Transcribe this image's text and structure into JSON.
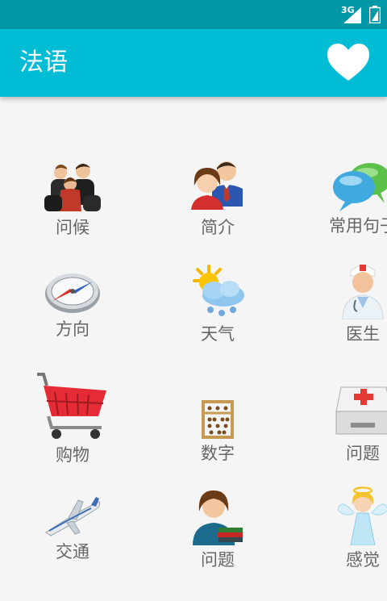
{
  "status_bar": {
    "network": "3G",
    "colors": {
      "bar": "#0097a7"
    }
  },
  "app_bar": {
    "title": "法语",
    "action_icon": "heart-icon",
    "color": "#00bcd4"
  },
  "grid": {
    "items": [
      {
        "label": "问候",
        "icon": "people-greeting-icon"
      },
      {
        "label": "简介",
        "icon": "couple-profile-icon"
      },
      {
        "label": "常用句子",
        "icon": "chat-bubbles-icon"
      },
      {
        "label": "方向",
        "icon": "compass-icon"
      },
      {
        "label": "天气",
        "icon": "weather-icon"
      },
      {
        "label": "医生",
        "icon": "doctor-icon"
      },
      {
        "label": "购物",
        "icon": "shopping-cart-icon"
      },
      {
        "label": "数字",
        "icon": "abacus-icon"
      },
      {
        "label": "问题",
        "icon": "first-aid-kit-icon"
      },
      {
        "label": "交通",
        "icon": "airplane-icon"
      },
      {
        "label": "问题",
        "icon": "student-books-icon"
      },
      {
        "label": "感觉",
        "icon": "angel-icon"
      }
    ]
  }
}
